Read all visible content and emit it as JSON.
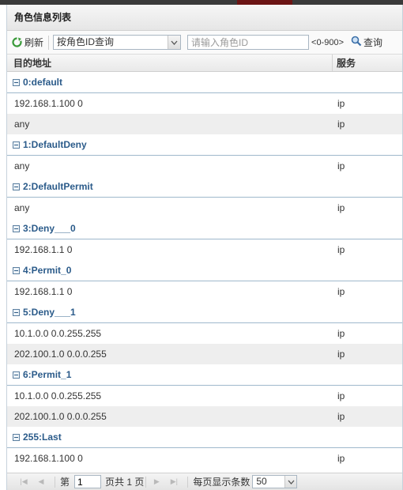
{
  "panel": {
    "title": "角色信息列表"
  },
  "toolbar": {
    "refresh_label": "刷新",
    "query_type": "按角色ID查询",
    "search_placeholder": "请输入角色ID",
    "range_hint": "<0-900>",
    "query_label": "查询"
  },
  "columns": {
    "address": "目的地址",
    "service": "服务"
  },
  "groups": [
    {
      "label": "0:default",
      "rows": [
        {
          "address": "192.168.1.100 0",
          "service": "ip"
        },
        {
          "address": "any",
          "service": "ip"
        }
      ]
    },
    {
      "label": "1:DefaultDeny",
      "rows": [
        {
          "address": "any",
          "service": "ip"
        }
      ]
    },
    {
      "label": "2:DefaultPermit",
      "rows": [
        {
          "address": "any",
          "service": "ip"
        }
      ]
    },
    {
      "label": "3:Deny___0",
      "rows": [
        {
          "address": "192.168.1.1 0",
          "service": "ip"
        }
      ]
    },
    {
      "label": "4:Permit_0",
      "rows": [
        {
          "address": "192.168.1.1 0",
          "service": "ip"
        }
      ]
    },
    {
      "label": "5:Deny___1",
      "rows": [
        {
          "address": "10.1.0.0 0.0.255.255",
          "service": "ip"
        },
        {
          "address": "202.100.1.0 0.0.0.255",
          "service": "ip"
        }
      ]
    },
    {
      "label": "6:Permit_1",
      "rows": [
        {
          "address": "10.1.0.0 0.0.255.255",
          "service": "ip"
        },
        {
          "address": "202.100.1.0 0.0.0.255",
          "service": "ip"
        }
      ]
    },
    {
      "label": "255:Last",
      "rows": [
        {
          "address": "192.168.1.100 0",
          "service": "ip"
        }
      ]
    }
  ],
  "pager": {
    "page_prefix": "第",
    "page_value": "1",
    "page_suffix": "页共 1 页",
    "page_size_label": "每页显示条数",
    "page_size": "50"
  },
  "colors": {
    "group_text": "#2b5b8a",
    "group_border": "#9fb8cc",
    "alt_row": "#eeeeee"
  }
}
